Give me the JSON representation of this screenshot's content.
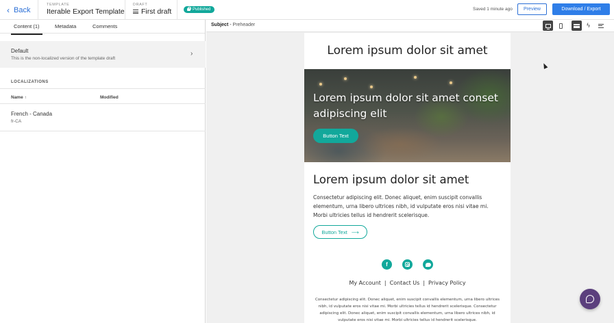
{
  "topbar": {
    "back_label": "Back",
    "template_label": "TEMPLATE",
    "template_name": "Iterable Export Template",
    "draft_label": "DRAFT",
    "draft_name": "First draft",
    "status_badge": "Published",
    "saved_text": "Saved 1 minute ago",
    "preview_label": "Preview",
    "download_label": "Download / Export"
  },
  "left_panel": {
    "tabs": [
      {
        "label": "Content (1)",
        "active": true
      },
      {
        "label": "Metadata",
        "active": false
      },
      {
        "label": "Comments",
        "active": false
      }
    ],
    "default_item": {
      "title": "Default",
      "subtitle": "This is the non-localized version of the template draft"
    },
    "localizations_title": "LOCALIZATIONS",
    "columns": {
      "name": "Name ↑",
      "modified": "Modified"
    },
    "localizations": [
      {
        "name": "French - Canada",
        "code": "fr-CA",
        "modified": ""
      }
    ]
  },
  "preview_bar": {
    "subject_label": "Subject",
    "separator": " - ",
    "preheader": "Preheader",
    "view_buttons": [
      "desktop-view",
      "mobile-view",
      "card-view",
      "amp-view",
      "text-view"
    ]
  },
  "email": {
    "title": "Lorem ipsum dolor sit amet",
    "hero_text": "Lorem ipsum dolor sit amet conset adipiscing elit",
    "hero_button": "Button Text",
    "heading": "Lorem ipsum dolor sit amet",
    "body": "Consectetur adipiscing elit. Donec aliquet, enim suscipit convallis elementum, urna libero ultrices nibh, id vulputate eros nisi vitae mi. Morbi ultricies tellus id hendrerit scelerisque.",
    "outline_button": "Button Text",
    "outline_arrow": "⟶",
    "social_icons": [
      "facebook-icon",
      "instagram-icon",
      "twitter-icon"
    ],
    "footer_links": [
      "My Account",
      "Contact Us",
      "Privacy Policy"
    ],
    "footer_separator": "|",
    "footer_fine_print": "Consectetur adipiscing elit. Donec aliquet, enim suscipit convallis elementum, urna libero ultrices nibh, id vulputate eros nisi vitae mi. Morbi ultricies tellus id hendrerit scelerisque. Consectetur adipiscing elit. Donec aliquet, enim suscipit convallis elementum, urna libero ultrices nibh, id vulputate eros nisi vitae mi. Morbi ultricies tellus id hendrerit scelerisque."
  },
  "colors": {
    "accent_blue": "#2f7ee8",
    "teal": "#12a89b",
    "chat_purple": "#5b3f7d"
  }
}
